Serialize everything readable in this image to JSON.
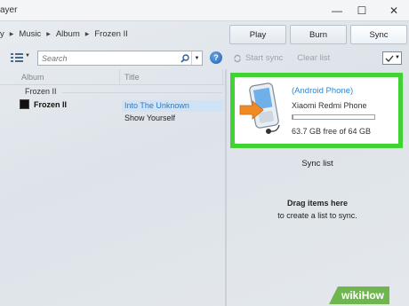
{
  "window": {
    "title": "ayer",
    "minimize_glyph": "—",
    "maximize_glyph": "☐",
    "close_glyph": "✕"
  },
  "breadcrumb": {
    "items": [
      "y",
      "Music",
      "Album",
      "Frozen II"
    ]
  },
  "tabs": [
    {
      "label": "Play"
    },
    {
      "label": "Burn"
    },
    {
      "label": "Sync"
    }
  ],
  "toolbar": {
    "search_placeholder": "Search",
    "help_glyph": "?",
    "start_sync": "Start sync",
    "clear_list": "Clear list"
  },
  "library": {
    "columns": [
      "Album",
      "Title"
    ],
    "group": "Frozen II",
    "album": "Frozen II",
    "tracks": [
      {
        "title": "Into The Unknown",
        "selected": true
      },
      {
        "title": "Show Yourself",
        "selected": false
      }
    ]
  },
  "device": {
    "name": "(Android Phone)",
    "model": "Xiaomi Redmi Phone",
    "free_text": "63.7 GB free of 64 GB",
    "used_fraction": 0.01,
    "highlight_color": "#41d334"
  },
  "sync": {
    "list_title": "Sync list",
    "drag_main": "Drag items here",
    "drag_sub": "to create a list to sync."
  },
  "watermark": {
    "wiki": "wiki",
    "how": "How"
  }
}
